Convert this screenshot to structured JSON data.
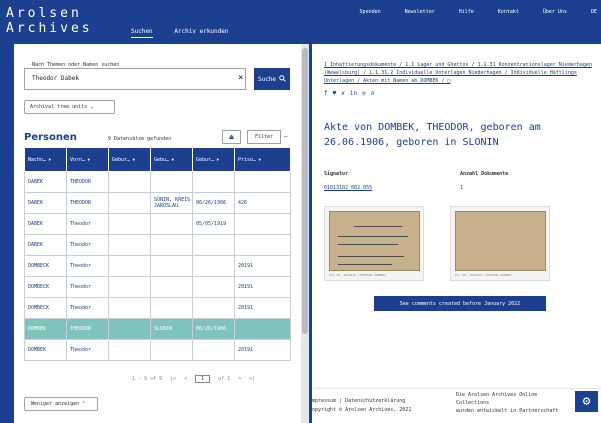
{
  "header": {
    "logo_line1": "Arolsen",
    "logo_line2": "Archives",
    "nav": [
      "Suchen",
      "Archiv erkunden"
    ],
    "links": [
      "Spenden",
      "Newsletter",
      "Hilfe",
      "Kontakt",
      "Über Uns",
      "DE"
    ]
  },
  "search": {
    "label": "Nach Themen oder Namen suchen",
    "value": "Theodor Dabek",
    "button": "Suche"
  },
  "tree_button": "Archival tree units",
  "results": {
    "title": "Personen",
    "count": "9 Datensätze gefunden",
    "filter_button": "Filter",
    "columns": [
      "Nachn…",
      "Vorn…",
      "Gebur…",
      "Gebu…",
      "Gebur…",
      "Priso…"
    ],
    "rows": [
      [
        "DABEK",
        "THEODOR",
        "",
        "",
        "",
        ""
      ],
      [
        "DABEK",
        "THEODOR",
        "",
        "SONIN, KREIS JAROSLAU",
        "06/26/1906",
        "426"
      ],
      [
        "DABEK",
        "Theodor",
        "",
        "",
        "05/05/1919",
        ""
      ],
      [
        "DABEK",
        "Theodor",
        "",
        "",
        "",
        ""
      ],
      [
        "DOMBECK",
        "Theodor",
        "",
        "",
        "",
        "20191"
      ],
      [
        "DOMBECK",
        "Theodor",
        "",
        "",
        "",
        "20191"
      ],
      [
        "DOMBECK",
        "Theodor",
        "",
        "",
        "",
        "20191"
      ],
      [
        "DOMBEK",
        "THEODOR",
        "",
        "SLONIN",
        "06/26/1906",
        ""
      ],
      [
        "DOMBEK",
        "Theodor",
        "",
        "",
        "",
        "20191"
      ]
    ],
    "highlight_row": 7
  },
  "pager": {
    "range": "1 - 9 of 9",
    "first": "|<",
    "prev": "<",
    "page": "1",
    "of": "of 1",
    "next": ">",
    "last": ">|"
  },
  "less_button": "Weniger anzeigen",
  "detail": {
    "breadcrumb": "1 Inhaftierungsdokumente / 1.1 Lager und Ghettos / 1.1.31 Konzentrationslager Niederhagen (Wewelsburg) / 1.1.31.2 Individuelle Unterlagen Niederhagen / Individuelle Häftlings Unterlagen / Akten mit Namen ab DOMBEK / □",
    "social": [
      "f",
      "♥",
      "✗",
      "in",
      "◎",
      "∂"
    ],
    "title": "Akte von DOMBEK, THEODOR, geboren am 26.06.1906, geboren in SLONIN",
    "signatur_label": "Signatur",
    "signatur_value": "01013102 002 055",
    "anzahl_label": "Anzahl Dokumente",
    "anzahl_value": "1",
    "card_caption_1": "Doc-ID: 2044416 (THEODOR DOMBEK)",
    "card_caption_2": "Doc-ID: 2044416 (THEODOR DOMBEK)",
    "comments_button": "See comments created before January 2022"
  },
  "footer": {
    "left_1": "mpressum | Datenschutzerklärung",
    "left_2": "opyright © Arolsen Archives, 2021",
    "right_1": "Die Arolsen Archives Online",
    "right_2": "Collections",
    "right_3": "wurden entwickelt in Partnerschaft"
  },
  "colors": {
    "brand": "#1c3f8f",
    "highlight": "#7fc3bd"
  }
}
